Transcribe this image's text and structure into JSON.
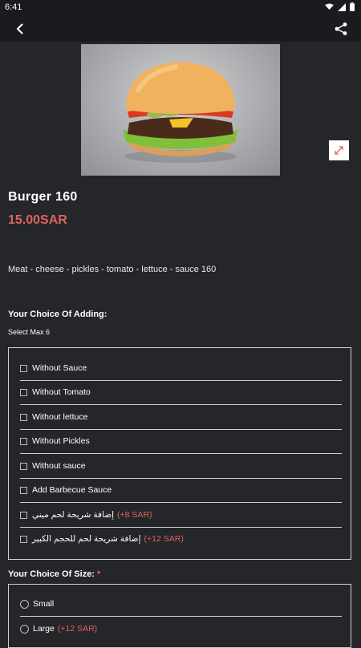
{
  "status_bar": {
    "time": "6:41"
  },
  "product": {
    "title": "Burger 160",
    "price": "15.00SAR",
    "description": "Meat - cheese - pickles - tomato - lettuce - sauce 160"
  },
  "adding_section": {
    "title": "Your Choice Of Adding:",
    "note": "Select Max 6",
    "options": [
      {
        "label": "Without Sauce",
        "extra": ""
      },
      {
        "label": "Without Tomato",
        "extra": ""
      },
      {
        "label": "Without lettuce",
        "extra": ""
      },
      {
        "label": "Without Pickles",
        "extra": ""
      },
      {
        "label": "Without sauce",
        "extra": ""
      },
      {
        "label": "Add Barbecue Sauce",
        "extra": ""
      },
      {
        "label": "إضافة شريحة لحم ميني",
        "extra": "(+8 SAR)"
      },
      {
        "label": "إضافة شريحة لحم للحجم الكبير",
        "extra": "(+12 SAR)"
      }
    ]
  },
  "size_section": {
    "title": "Your Choice Of Size:",
    "required_mark": "*",
    "options": [
      {
        "label": "Small",
        "extra": ""
      },
      {
        "label": "Large",
        "extra": "(+12 SAR)"
      }
    ]
  },
  "colors": {
    "background": "#25262a",
    "accent": "#e0635f",
    "bar": "#1a1b1f"
  }
}
